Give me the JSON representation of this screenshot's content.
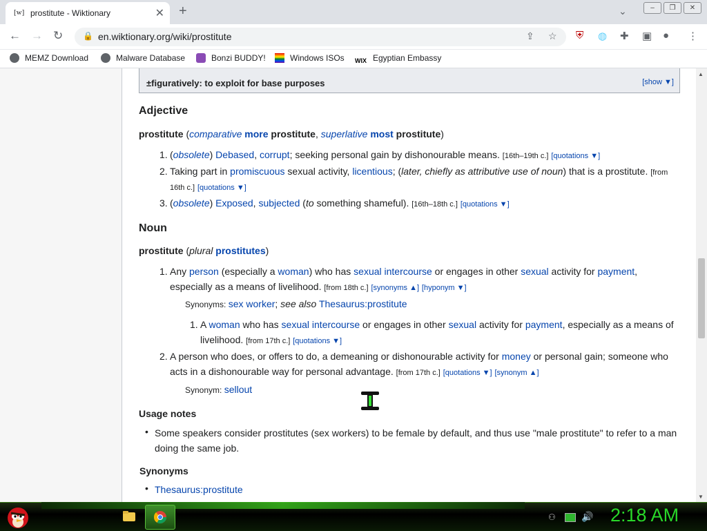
{
  "browser": {
    "tab_title": "prostitute - Wiktionary",
    "tab_favicon": "[w]",
    "url": "en.wiktionary.org/wiki/prostitute"
  },
  "bookmarks": [
    "MEMZ Download",
    "Malware Database",
    "Bonzi BUDDY!",
    "Windows ISOs",
    "Egyptian Embassy"
  ],
  "navbox": {
    "label": "±figuratively: to exploit for base purposes",
    "show": "[show ▼]"
  },
  "adjective": {
    "heading": "Adjective",
    "head_word": "prostitute",
    "head_tail": [
      {
        "t": " (",
        "s": "plain"
      },
      {
        "t": "comparative",
        "s": "ilink"
      },
      {
        "t": " ",
        "s": "plain"
      },
      {
        "t": "more",
        "s": "blink"
      },
      {
        "t": " prostitute",
        "s": "bold"
      },
      {
        "t": ", ",
        "s": "plain"
      },
      {
        "t": "superlative",
        "s": "ilink"
      },
      {
        "t": " ",
        "s": "plain"
      },
      {
        "t": "most",
        "s": "blink"
      },
      {
        "t": " prostitute",
        "s": "bold"
      },
      {
        "t": ")",
        "s": "plain"
      }
    ],
    "senses": [
      {
        "n": "1.",
        "lines": [
          [
            {
              "t": "(",
              "s": "plain"
            },
            {
              "t": "obsolete",
              "s": "ilink"
            },
            {
              "t": ") ",
              "s": "plain"
            },
            {
              "t": "Debased",
              "s": "link"
            },
            {
              "t": ", ",
              "s": "plain"
            },
            {
              "t": "corrupt",
              "s": "link"
            },
            {
              "t": "; seeking personal gain by dishonourable means. ",
              "s": "plain"
            },
            {
              "t": "[16th–19th c.]",
              "s": "small"
            },
            {
              "t": "  ",
              "s": "plain"
            },
            {
              "t": "[quotations ▼]",
              "s": "slink"
            }
          ]
        ]
      },
      {
        "n": "2.",
        "lines": [
          [
            {
              "t": "Taking part in ",
              "s": "plain"
            },
            {
              "t": "promiscuous",
              "s": "link"
            },
            {
              "t": " sexual activity, ",
              "s": "plain"
            },
            {
              "t": "licentious",
              "s": "link"
            },
            {
              "t": "; (",
              "s": "plain"
            },
            {
              "t": "later, chiefly as attributive use of noun",
              "s": "ital"
            },
            {
              "t": ") that is a prostitute. ",
              "s": "plain"
            },
            {
              "t": "[from",
              "s": "small"
            }
          ],
          [
            {
              "t": "16th c.]",
              "s": "small"
            },
            {
              "t": "  ",
              "s": "plain"
            },
            {
              "t": "[quotations ▼]",
              "s": "slink"
            }
          ]
        ]
      },
      {
        "n": "3.",
        "lines": [
          [
            {
              "t": "(",
              "s": "plain"
            },
            {
              "t": "obsolete",
              "s": "ilink"
            },
            {
              "t": ") ",
              "s": "plain"
            },
            {
              "t": "Exposed",
              "s": "link"
            },
            {
              "t": ", ",
              "s": "plain"
            },
            {
              "t": "subjected",
              "s": "link"
            },
            {
              "t": " (",
              "s": "plain"
            },
            {
              "t": "to",
              "s": "ital"
            },
            {
              "t": " something shameful). ",
              "s": "plain"
            },
            {
              "t": "[16th–18th c.]",
              "s": "small"
            },
            {
              "t": "  ",
              "s": "plain"
            },
            {
              "t": "[quotations ▼]",
              "s": "slink"
            }
          ]
        ]
      }
    ]
  },
  "noun": {
    "heading": "Noun",
    "head_word": "prostitute",
    "head_tail": [
      {
        "t": " (",
        "s": "plain"
      },
      {
        "t": "plural",
        "s": "ital"
      },
      {
        "t": " ",
        "s": "plain"
      },
      {
        "t": "prostitutes",
        "s": "blink"
      },
      {
        "t": ")",
        "s": "plain"
      }
    ],
    "sense1": {
      "n": "1.",
      "lines": [
        [
          {
            "t": "Any ",
            "s": "plain"
          },
          {
            "t": "person",
            "s": "link"
          },
          {
            "t": " (especially a ",
            "s": "plain"
          },
          {
            "t": "woman",
            "s": "link"
          },
          {
            "t": ") who has ",
            "s": "plain"
          },
          {
            "t": "sexual intercourse",
            "s": "link"
          },
          {
            "t": " or engages in other ",
            "s": "plain"
          },
          {
            "t": "sexual",
            "s": "link"
          },
          {
            "t": " activity for ",
            "s": "plain"
          },
          {
            "t": "payment",
            "s": "link"
          },
          {
            "t": ",",
            "s": "plain"
          }
        ],
        [
          {
            "t": "especially as a means of livelihood. ",
            "s": "plain"
          },
          {
            "t": "[from 18th c.]",
            "s": "small"
          },
          {
            "t": "  ",
            "s": "plain"
          },
          {
            "t": "[synonyms ▲]",
            "s": "slink"
          },
          {
            "t": " ",
            "s": "plain"
          },
          {
            "t": "[hyponym ▼]",
            "s": "slink"
          }
        ]
      ]
    },
    "syn1": [
      {
        "t": "Synonyms: ",
        "s": "smallish"
      },
      {
        "t": "sex worker",
        "s": "link"
      },
      {
        "t": "; ",
        "s": "plain"
      },
      {
        "t": "see also",
        "s": "ital"
      },
      {
        "t": " ",
        "s": "plain"
      },
      {
        "t": "Thesaurus:prostitute",
        "s": "link"
      }
    ],
    "sub1": {
      "n": "1.",
      "lines": [
        [
          {
            "t": "A ",
            "s": "plain"
          },
          {
            "t": "woman",
            "s": "link"
          },
          {
            "t": " who has ",
            "s": "plain"
          },
          {
            "t": "sexual intercourse",
            "s": "link"
          },
          {
            "t": " or engages in other ",
            "s": "plain"
          },
          {
            "t": "sexual",
            "s": "link"
          },
          {
            "t": " activity for ",
            "s": "plain"
          },
          {
            "t": "payment",
            "s": "link"
          },
          {
            "t": ", especially as a means of",
            "s": "plain"
          }
        ],
        [
          {
            "t": "livelihood. ",
            "s": "plain"
          },
          {
            "t": "[from 17th c.]",
            "s": "small"
          },
          {
            "t": "  ",
            "s": "plain"
          },
          {
            "t": "[quotations ▼]",
            "s": "slink"
          }
        ]
      ]
    },
    "sense2": {
      "n": "2.",
      "lines": [
        [
          {
            "t": "A person who does, or offers to do, a demeaning or dishonourable activity for ",
            "s": "plain"
          },
          {
            "t": "money",
            "s": "link"
          },
          {
            "t": " or personal gain; someone who",
            "s": "plain"
          }
        ],
        [
          {
            "t": "acts in a dishonourable way for personal advantage. ",
            "s": "plain"
          },
          {
            "t": "[from 17th c.]",
            "s": "small"
          },
          {
            "t": "  ",
            "s": "plain"
          },
          {
            "t": "[quotations ▼]",
            "s": "slink"
          },
          {
            "t": " ",
            "s": "plain"
          },
          {
            "t": "[synonym ▲]",
            "s": "slink"
          }
        ]
      ]
    },
    "syn2": [
      {
        "t": "Synonym: ",
        "s": "smallish"
      },
      {
        "t": "sellout",
        "s": "link"
      }
    ]
  },
  "usage": {
    "heading": "Usage notes",
    "line1": "Some speakers consider prostitutes (sex workers) to be female by default, and thus use \"male prostitute\" to refer to a man",
    "line2": "doing the same job."
  },
  "synonyms": {
    "heading": "Synonyms",
    "item": "Thesaurus:prostitute"
  },
  "taskbar": {
    "clock": "2:18 AM"
  },
  "colors": {
    "link": "#0645ad",
    "clock": "#29d829"
  }
}
